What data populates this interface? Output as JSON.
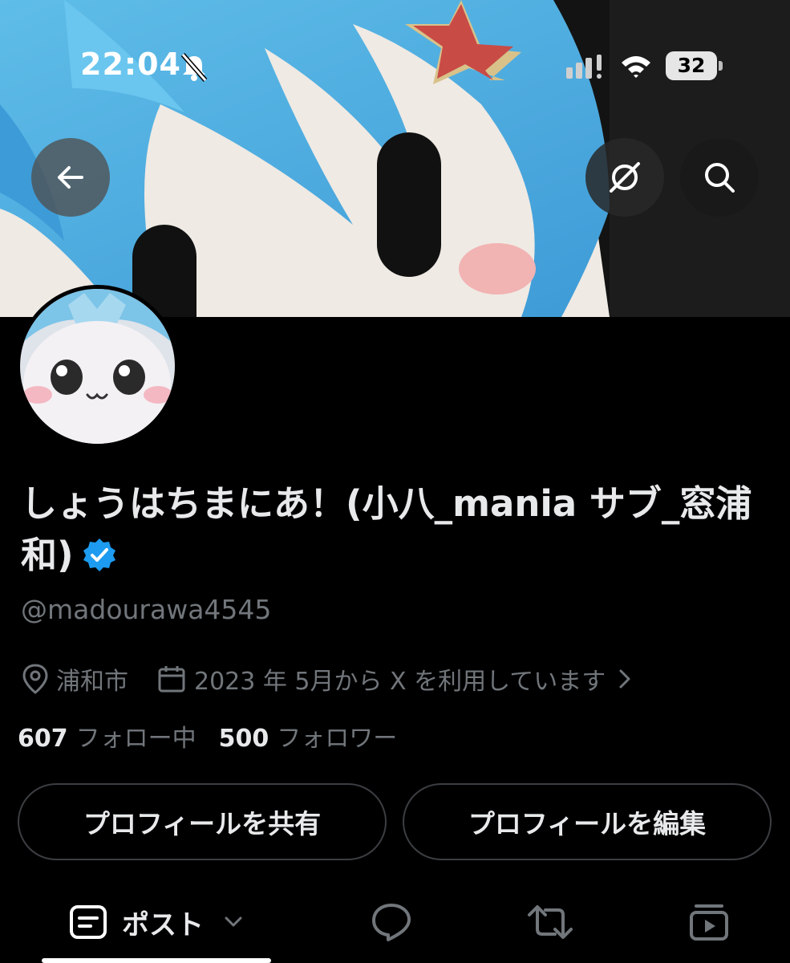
{
  "status_bar": {
    "time": "22:04",
    "battery_level": "32"
  },
  "header": {
    "back_icon": "arrow-left-icon",
    "grok_icon": "grok-icon",
    "search_icon": "search-icon"
  },
  "profile": {
    "display_name": "しょうはちまにあ！(小八_mania サブ_窓浦和)",
    "verified": true,
    "handle": "@madourawa4545",
    "location": "浦和市",
    "joined": "2023 年 5月から X を利用しています",
    "following_count": "607",
    "following_label": "フォロー中",
    "followers_count": "500",
    "followers_label": "フォロワー"
  },
  "actions": {
    "share_label": "プロフィールを共有",
    "edit_label": "プロフィールを編集"
  },
  "tabs": {
    "posts_label": "ポスト",
    "active": "posts"
  },
  "colors": {
    "background": "#000000",
    "primary_text": "#e7e9ea",
    "secondary_text": "#71767b",
    "verified_blue": "#1d9bf0",
    "button_border": "#3b3e42"
  }
}
